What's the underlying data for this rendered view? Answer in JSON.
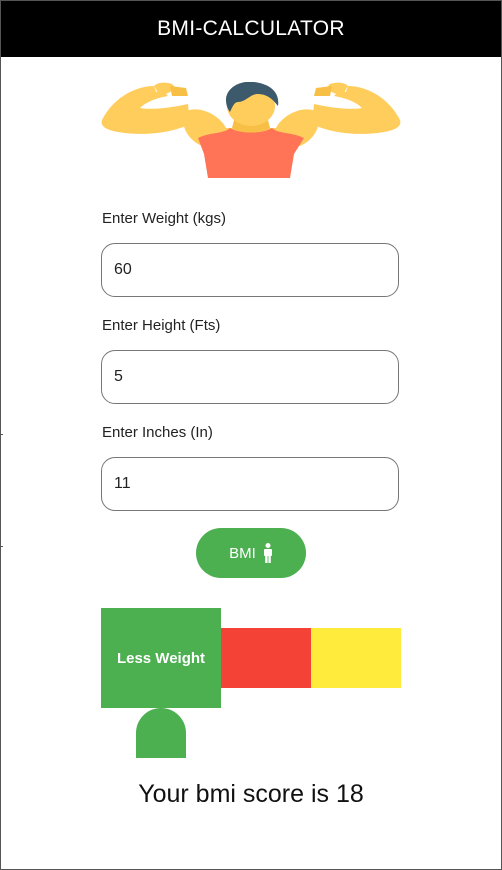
{
  "app": {
    "title": "BMI-CALCULATOR"
  },
  "form": {
    "weight": {
      "label": "Enter Weight (kgs)",
      "value": "60"
    },
    "height": {
      "label": "Enter Height (Fts)",
      "value": "5"
    },
    "inches": {
      "label": "Enter Inches (In)",
      "value": "11"
    }
  },
  "button": {
    "label": "BMI",
    "icon": "person-icon"
  },
  "scale": {
    "segments": [
      {
        "label": "Less Weight",
        "color": "#4caf50",
        "active": true
      },
      {
        "label": "",
        "color": "#f44336",
        "active": false
      },
      {
        "label": "",
        "color": "#ffeb3b",
        "active": false
      }
    ]
  },
  "result": {
    "text": "Your bmi score is 18"
  }
}
